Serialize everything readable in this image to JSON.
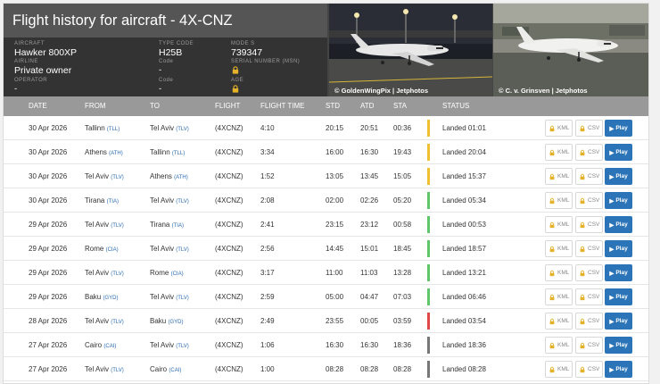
{
  "header": {
    "title": "Flight history for aircraft - 4X-CNZ",
    "aircraft_label": "AIRCRAFT",
    "aircraft_value": "Hawker 800XP",
    "type_code_label": "TYPE CODE",
    "type_code_value": "H25B",
    "mode_s_label": "MODE S",
    "mode_s_value": "739347",
    "airline_label": "AIRLINE",
    "airline_value": "Private owner",
    "airline_code_label": "Code",
    "airline_code_value": "-",
    "msn_label": "SERIAL NUMBER (MSN)",
    "operator_label": "OPERATOR",
    "operator_value": "-",
    "operator_code_label": "Code",
    "operator_code_value": "-",
    "age_label": "AGE"
  },
  "photos": [
    {
      "caption": "© GoldenWingPix | Jetphotos"
    },
    {
      "caption": "© C. v. Grinsven | Jetphotos"
    }
  ],
  "columns": {
    "date": "DATE",
    "from": "FROM",
    "to": "TO",
    "flight": "FLIGHT",
    "flight_time": "FLIGHT TIME",
    "std": "STD",
    "atd": "ATD",
    "sta": "STA",
    "status": "STATUS"
  },
  "buttons": {
    "kml": "KML",
    "csv": "CSV",
    "play": "Play"
  },
  "colors": {
    "yellow": "#f0c030",
    "green": "#5fc76a",
    "red": "#e04848",
    "gray": "#777777",
    "play": "#2b74b8"
  },
  "flights": [
    {
      "date": "30 Apr 2026",
      "from_city": "Tallinn",
      "from_code": "(TLL)",
      "to_city": "Tel Aviv",
      "to_code": "(TLV)",
      "flight": "(4XCNZ)",
      "flight_time": "4:10",
      "std": "20:15",
      "atd": "20:51",
      "sta": "00:36",
      "status": "Landed 01:01",
      "bar": "yellow"
    },
    {
      "date": "30 Apr 2026",
      "from_city": "Athens",
      "from_code": "(ATH)",
      "to_city": "Tallinn",
      "to_code": "(TLL)",
      "flight": "(4XCNZ)",
      "flight_time": "3:34",
      "std": "16:00",
      "atd": "16:30",
      "sta": "19:43",
      "status": "Landed 20:04",
      "bar": "yellow"
    },
    {
      "date": "30 Apr 2026",
      "from_city": "Tel Aviv",
      "from_code": "(TLV)",
      "to_city": "Athens",
      "to_code": "(ATH)",
      "flight": "(4XCNZ)",
      "flight_time": "1:52",
      "std": "13:05",
      "atd": "13:45",
      "sta": "15:05",
      "status": "Landed 15:37",
      "bar": "yellow"
    },
    {
      "date": "30 Apr 2026",
      "from_city": "Tirana",
      "from_code": "(TIA)",
      "to_city": "Tel Aviv",
      "to_code": "(TLV)",
      "flight": "(4XCNZ)",
      "flight_time": "2:08",
      "std": "02:00",
      "atd": "02:26",
      "sta": "05:20",
      "status": "Landed 05:34",
      "bar": "green"
    },
    {
      "date": "29 Apr 2026",
      "from_city": "Tel Aviv",
      "from_code": "(TLV)",
      "to_city": "Tirana",
      "to_code": "(TIA)",
      "flight": "(4XCNZ)",
      "flight_time": "2:41",
      "std": "23:15",
      "atd": "23:12",
      "sta": "00:58",
      "status": "Landed 00:53",
      "bar": "green"
    },
    {
      "date": "29 Apr 2026",
      "from_city": "Rome",
      "from_code": "(CIA)",
      "to_city": "Tel Aviv",
      "to_code": "(TLV)",
      "flight": "(4XCNZ)",
      "flight_time": "2:56",
      "std": "14:45",
      "atd": "15:01",
      "sta": "18:45",
      "status": "Landed 18:57",
      "bar": "green"
    },
    {
      "date": "29 Apr 2026",
      "from_city": "Tel Aviv",
      "from_code": "(TLV)",
      "to_city": "Rome",
      "to_code": "(CIA)",
      "flight": "(4XCNZ)",
      "flight_time": "3:17",
      "std": "11:00",
      "atd": "11:03",
      "sta": "13:28",
      "status": "Landed 13:21",
      "bar": "green"
    },
    {
      "date": "29 Apr 2026",
      "from_city": "Baku",
      "from_code": "(GYD)",
      "to_city": "Tel Aviv",
      "to_code": "(TLV)",
      "flight": "(4XCNZ)",
      "flight_time": "2:59",
      "std": "05:00",
      "atd": "04:47",
      "sta": "07:03",
      "status": "Landed 06:46",
      "bar": "green"
    },
    {
      "date": "28 Apr 2026",
      "from_city": "Tel Aviv",
      "from_code": "(TLV)",
      "to_city": "Baku",
      "to_code": "(GYD)",
      "flight": "(4XCNZ)",
      "flight_time": "2:49",
      "std": "23:55",
      "atd": "00:05",
      "sta": "03:59",
      "status": "Landed 03:54",
      "bar": "red"
    },
    {
      "date": "27 Apr 2026",
      "from_city": "Cairo",
      "from_code": "(CAI)",
      "to_city": "Tel Aviv",
      "to_code": "(TLV)",
      "flight": "(4XCNZ)",
      "flight_time": "1:06",
      "std": "16:30",
      "atd": "16:30",
      "sta": "18:36",
      "status": "Landed 18:36",
      "bar": "gray"
    },
    {
      "date": "27 Apr 2026",
      "from_city": "Tel Aviv",
      "from_code": "(TLV)",
      "to_city": "Cairo",
      "to_code": "(CAI)",
      "flight": "(4XCNZ)",
      "flight_time": "1:00",
      "std": "08:28",
      "atd": "08:28",
      "sta": "08:28",
      "status": "Landed 08:28",
      "bar": "gray"
    }
  ]
}
